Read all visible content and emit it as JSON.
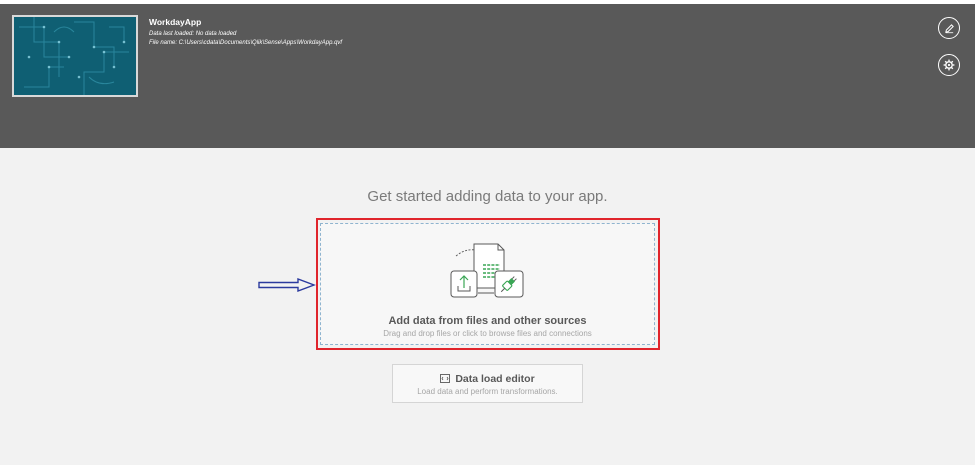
{
  "app": {
    "title": "WorkdayApp",
    "data_last_loaded": "Data last loaded: No data loaded",
    "file_name": "File name: C:\\Users\\cdata\\Documents\\Qlik\\Sense\\Apps\\WorkdayApp.qvf"
  },
  "header": {
    "background_color": "#595959",
    "edit_icon": "pencil-icon",
    "settings_icon": "gear-icon"
  },
  "main": {
    "headline": "Get started adding data to your app.",
    "add_data": {
      "title": "Add data from files and other sources",
      "subtitle": "Drag and drop files or click to browse files and connections",
      "icons": [
        "file-icon",
        "upload-icon",
        "connector-plug-icon"
      ],
      "highlight_color": "#e0242c"
    },
    "data_load_editor": {
      "title": "Data load editor",
      "subtitle": "Load data and perform transformations.",
      "icon": "script-editor-icon"
    },
    "annotation_arrow_icon": "right-arrow-icon"
  }
}
